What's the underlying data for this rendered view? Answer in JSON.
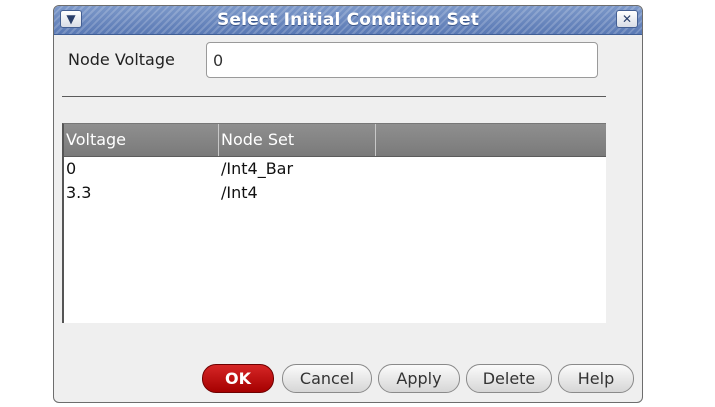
{
  "window": {
    "title": "Select Initial Condition Set",
    "menu_icon": "chevron-down-icon",
    "close_icon": "close-icon"
  },
  "form": {
    "node_voltage_label": "Node Voltage",
    "node_voltage_value": "0"
  },
  "table": {
    "columns": [
      "Voltage",
      "Node Set"
    ],
    "rows": [
      {
        "voltage": "0",
        "node_set": "/Int4_Bar"
      },
      {
        "voltage": "3.3",
        "node_set": "/Int4"
      }
    ]
  },
  "buttons": {
    "ok": "OK",
    "cancel": "Cancel",
    "apply": "Apply",
    "delete": "Delete",
    "help": "Help"
  }
}
